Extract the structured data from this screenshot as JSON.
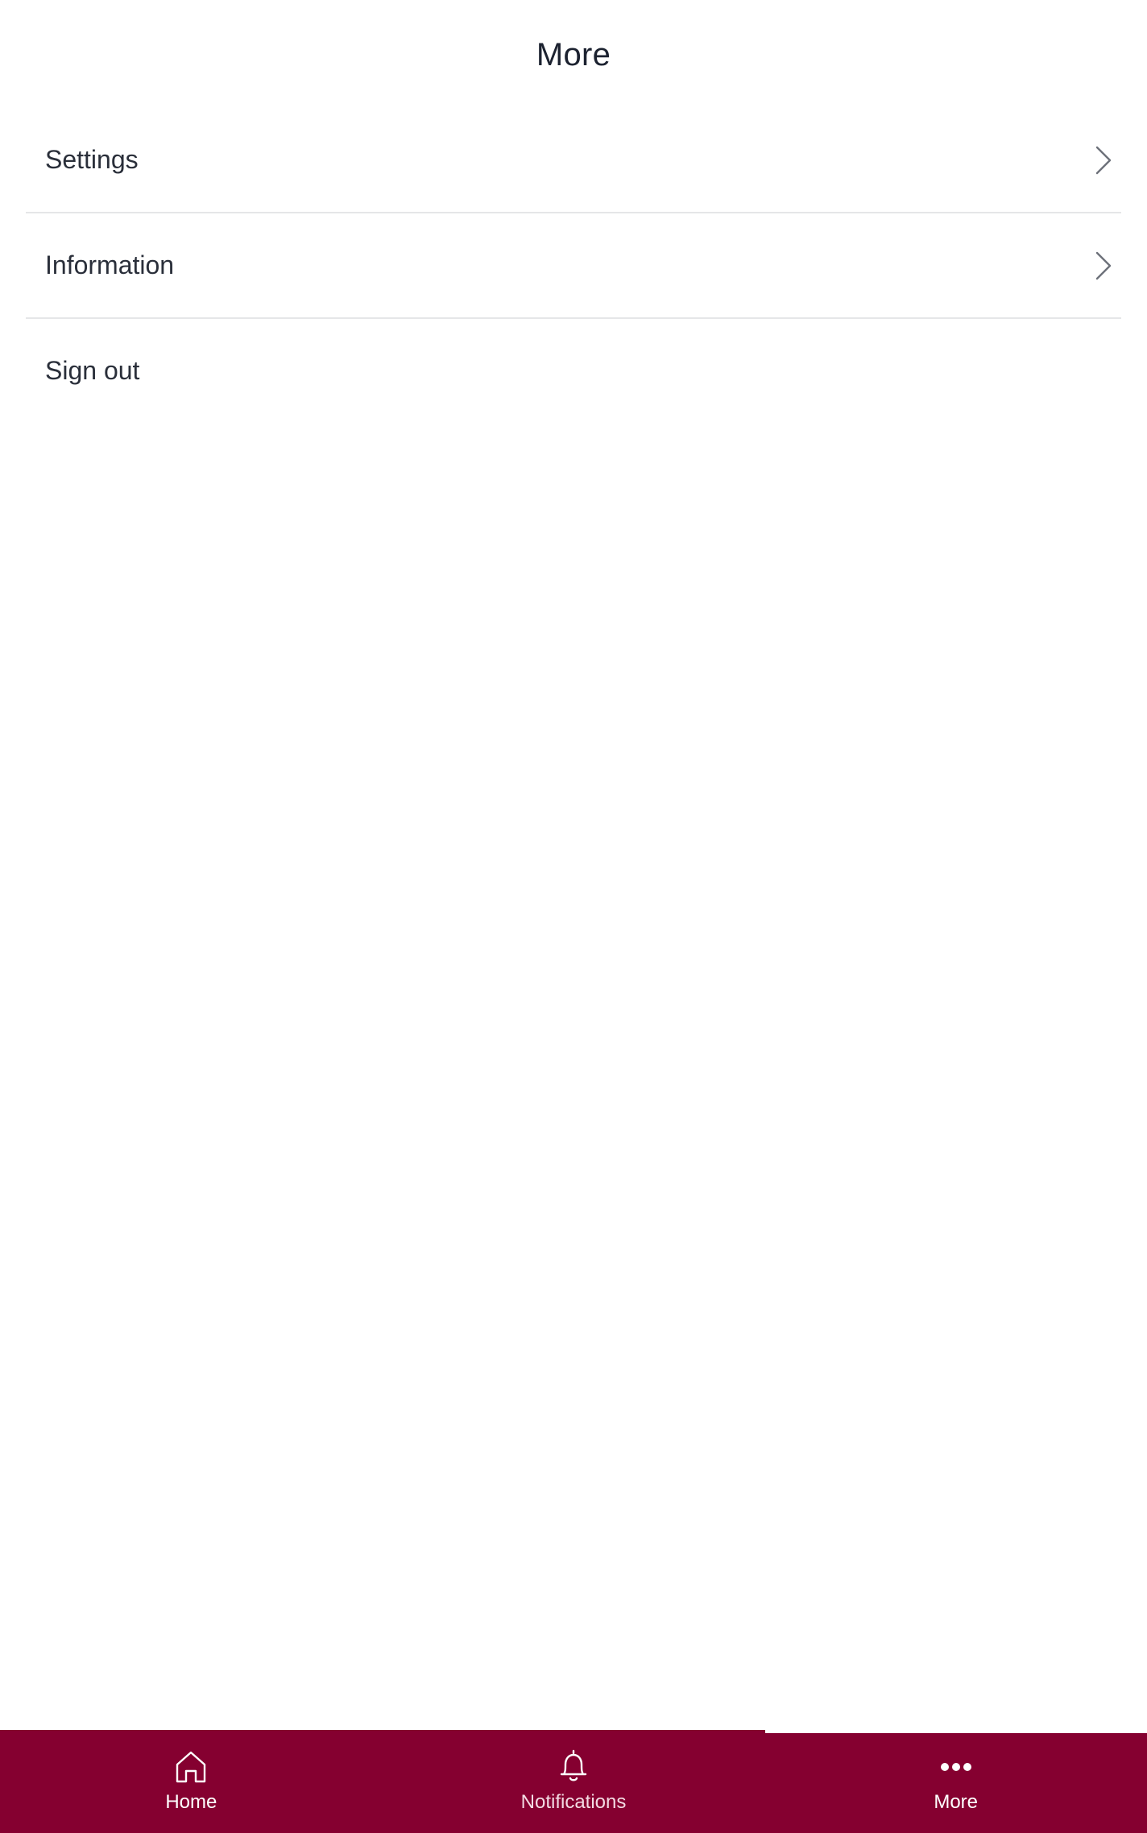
{
  "header": {
    "title": "More"
  },
  "menu": {
    "items": [
      {
        "label": "Settings",
        "icon": "chevron-right-icon"
      },
      {
        "label": "Information",
        "icon": "chevron-right-icon"
      },
      {
        "label": "Sign out"
      }
    ]
  },
  "tabbar": {
    "background": "#850030",
    "tabs": [
      {
        "label": "Home",
        "icon": "home-icon"
      },
      {
        "label": "Notifications",
        "icon": "bell-icon"
      },
      {
        "label": "More",
        "icon": "more-dots-icon",
        "selected": true
      }
    ]
  }
}
